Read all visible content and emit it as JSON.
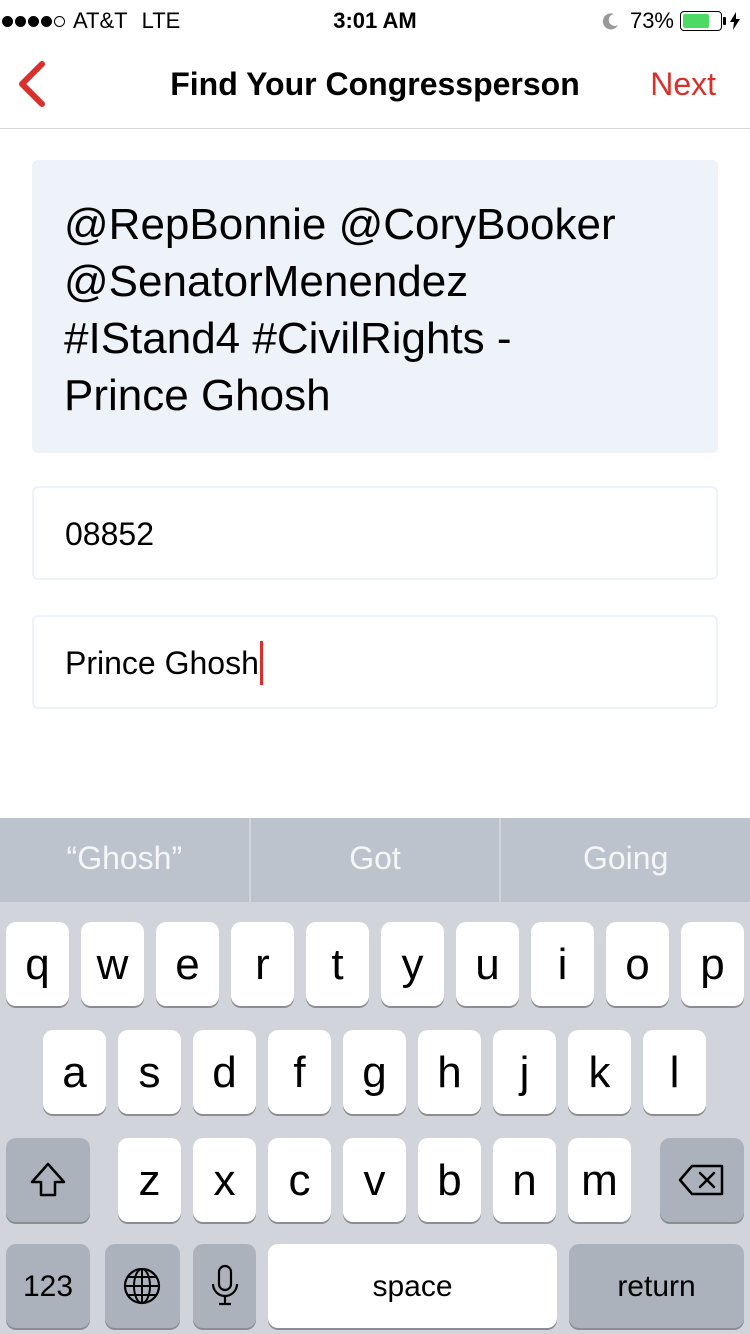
{
  "status_bar": {
    "carrier": "AT&T",
    "network": "LTE",
    "time": "3:01 AM",
    "battery": "73%",
    "battery_level": 0.73
  },
  "nav": {
    "title": "Find Your Congressperson",
    "next_label": "Next",
    "accent": "#d9302b"
  },
  "message": {
    "lines": [
      "@RepBonnie @CoryBooker",
      "@SenatorMenendez",
      "#IStand4 #CivilRights -",
      "Prince Ghosh"
    ]
  },
  "zip_field": {
    "value": "08852"
  },
  "name_field": {
    "value": "Prince Ghosh"
  },
  "suggestions": [
    "“Ghosh”",
    "Got",
    "Going"
  ],
  "keyboard": {
    "row1": [
      "q",
      "w",
      "e",
      "r",
      "t",
      "y",
      "u",
      "i",
      "o",
      "p"
    ],
    "row2": [
      "a",
      "s",
      "d",
      "f",
      "g",
      "h",
      "j",
      "k",
      "l"
    ],
    "row3": [
      "z",
      "x",
      "c",
      "v",
      "b",
      "n",
      "m"
    ],
    "numbers_label": "123",
    "space_label": "space",
    "return_label": "return"
  }
}
